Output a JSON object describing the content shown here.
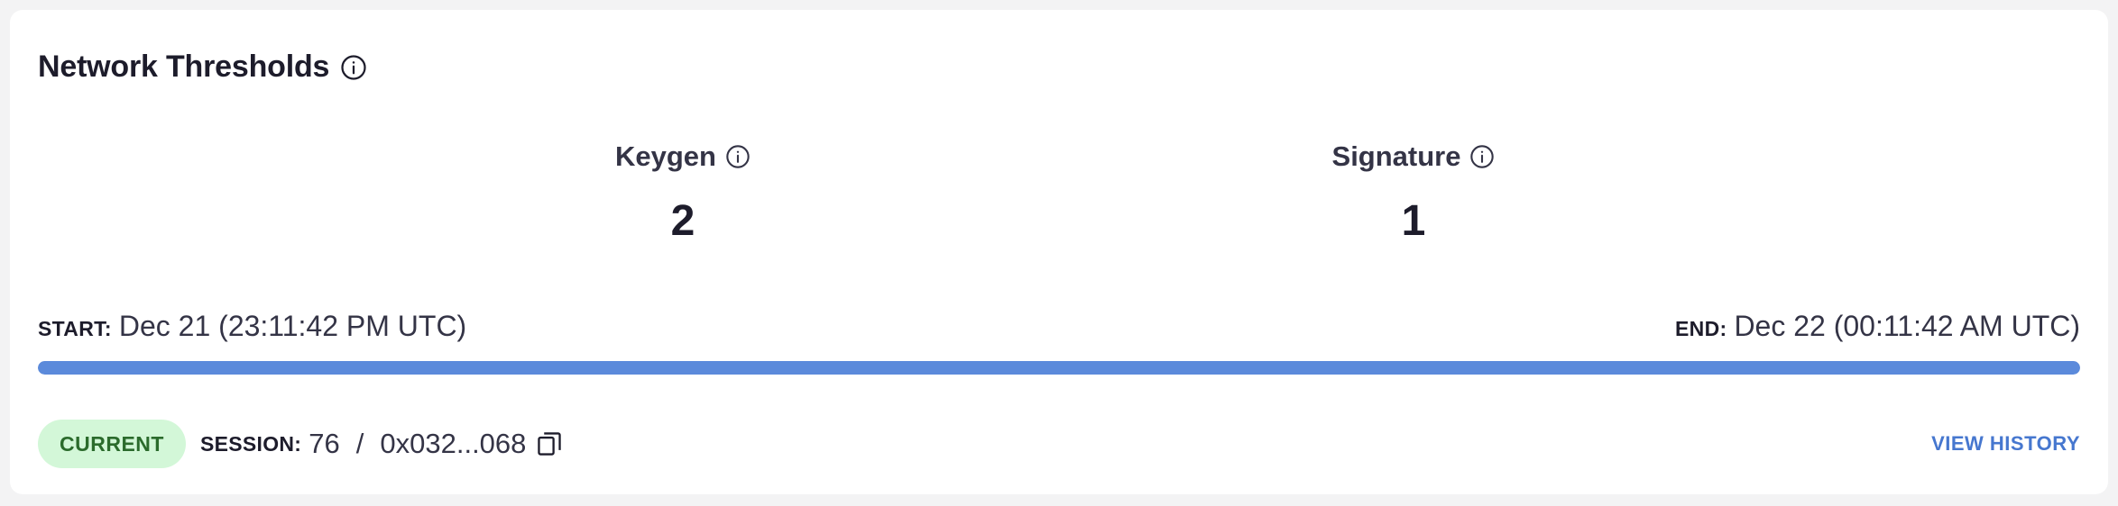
{
  "card": {
    "title": "Network Thresholds",
    "title_icon": "info-icon"
  },
  "stats": {
    "keygen": {
      "label": "Keygen",
      "value": "2",
      "icon": "info-icon"
    },
    "signature": {
      "label": "Signature",
      "value": "1",
      "icon": "info-icon"
    }
  },
  "times": {
    "start_label": "START:",
    "start_value": "Dec 21 (23:11:42 PM UTC)",
    "end_label": "END:",
    "end_value": "Dec 22 (00:11:42 AM UTC)"
  },
  "progress": {
    "percent": 100,
    "color": "#5b8adb"
  },
  "footer": {
    "badge": "CURRENT",
    "session_label": "SESSION:",
    "session_number": "76",
    "separator": "/",
    "session_hash": "0x032...068",
    "copy_icon": "copy-icon",
    "view_history": "VIEW HISTORY"
  },
  "colors": {
    "badge_bg": "#d3f7d8",
    "badge_text": "#2b6b2c",
    "link": "#4677cf"
  }
}
